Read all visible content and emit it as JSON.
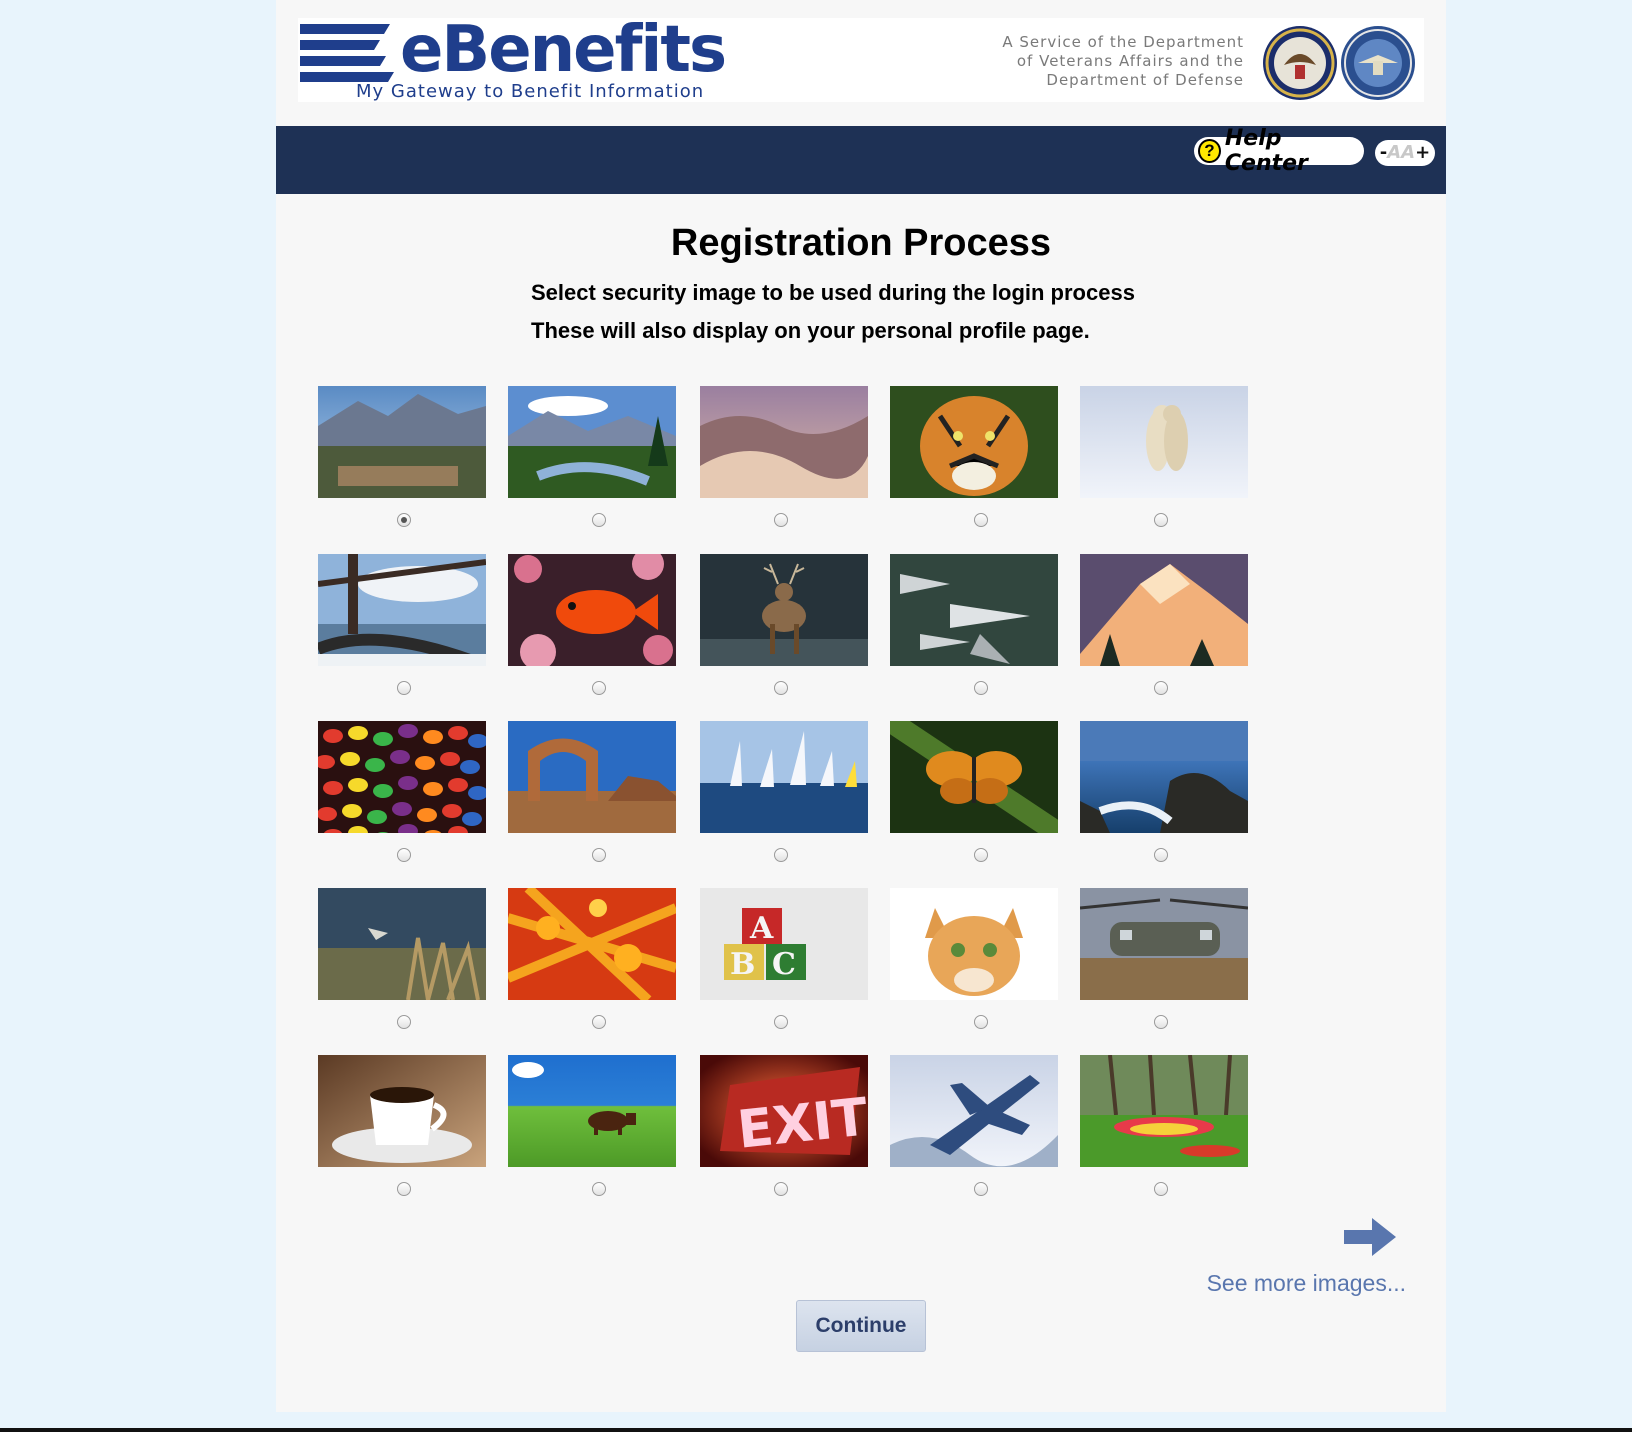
{
  "header": {
    "logo_text": "eBenefits",
    "logo_tagline": "My Gateway to Benefit Information",
    "service_text": "A Service of the Department of Veterans Affairs and the Department of Defense",
    "seals": [
      "va-seal-icon",
      "dod-seal-icon"
    ]
  },
  "navbar": {
    "help_label": "Help Center",
    "help_icon": "question-circle-icon",
    "font_size_label": "-AA+",
    "font_minus": "-",
    "font_aa": "AA",
    "font_plus": "+"
  },
  "main": {
    "title": "Registration Process",
    "subtitle_1": "Select security image to be used during the login process",
    "subtitle_2": "These will also display on your personal profile page.",
    "selected_index": 0,
    "images": [
      "mountain-town",
      "mountain-stream",
      "desert-dunes",
      "tiger",
      "polar-bears",
      "golden-gate-bridge",
      "red-fish",
      "deer",
      "fighter-jets",
      "snowy-peak",
      "jelly-beans",
      "desert-arch",
      "sailboats",
      "butterfly",
      "rocky-coast",
      "bird-marsh",
      "autumn-leaves",
      "abc-blocks",
      "kitten",
      "helicopter",
      "coffee-cup",
      "cow-field",
      "exit-sign",
      "jet-snow",
      "tulip-garden"
    ],
    "see_more": "See more images...",
    "continue": "Continue"
  },
  "colors": {
    "navbar": "#1e3155",
    "brand_blue": "#1f3e8c",
    "link": "#5976ae",
    "page_bg": "#e8f4fc"
  }
}
